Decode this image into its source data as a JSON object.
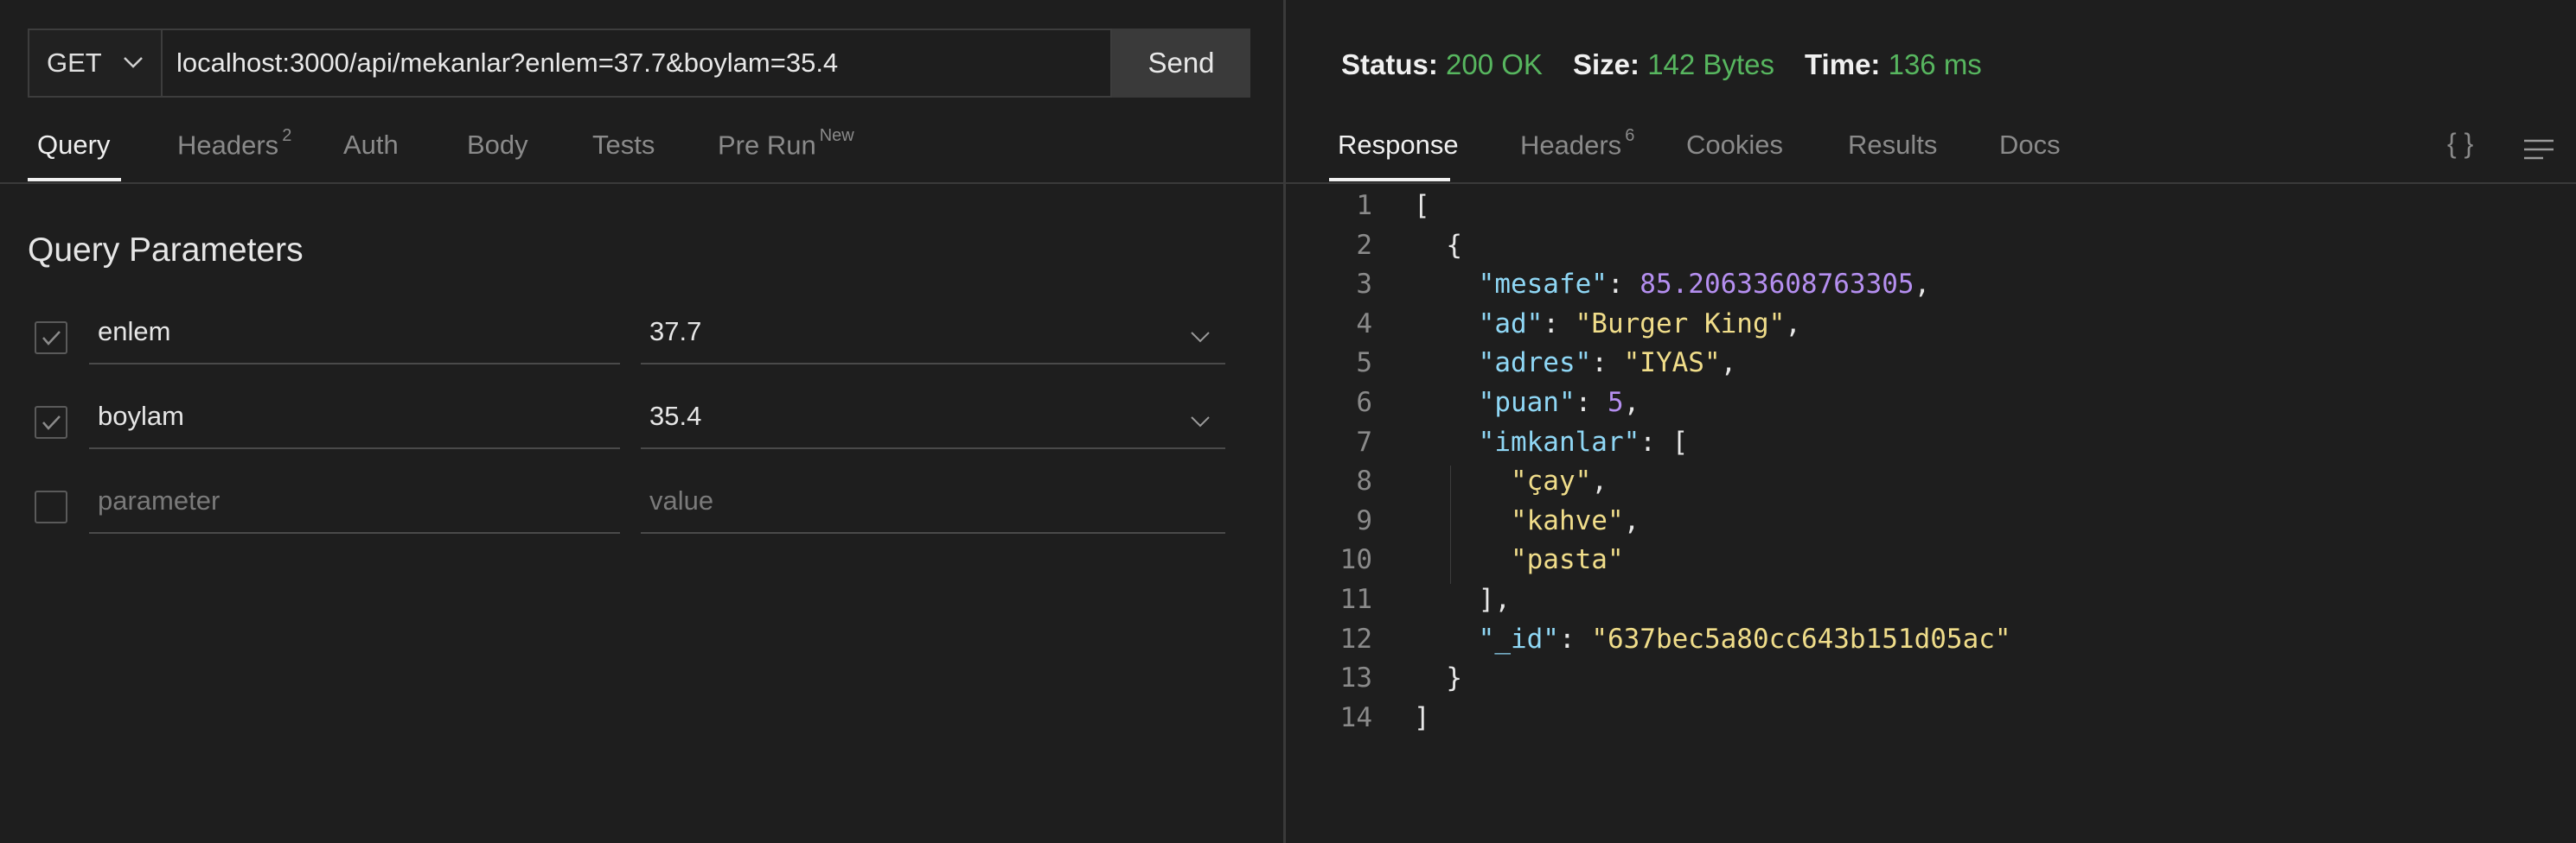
{
  "request": {
    "method": "GET",
    "url": "localhost:3000/api/mekanlar?enlem=37.7&boylam=35.4",
    "send_label": "Send"
  },
  "request_tabs": [
    {
      "label": "Query",
      "badge": ""
    },
    {
      "label": "Headers",
      "badge": "2"
    },
    {
      "label": "Auth",
      "badge": ""
    },
    {
      "label": "Body",
      "badge": ""
    },
    {
      "label": "Tests",
      "badge": ""
    },
    {
      "label": "Pre Run",
      "badge": "New"
    }
  ],
  "query": {
    "title": "Query Parameters",
    "params": [
      {
        "name": "enlem",
        "value": "37.7",
        "checked": true
      },
      {
        "name": "boylam",
        "value": "35.4",
        "checked": true
      }
    ],
    "new_row": {
      "name_placeholder": "parameter",
      "value_placeholder": "value"
    }
  },
  "response": {
    "status_label": "Status:",
    "status_value": "200 OK",
    "size_label": "Size:",
    "size_value": "142 Bytes",
    "time_label": "Time:",
    "time_value": "136 ms",
    "tabs": [
      {
        "label": "Response",
        "badge": ""
      },
      {
        "label": "Headers",
        "badge": "6"
      },
      {
        "label": "Cookies",
        "badge": ""
      },
      {
        "label": "Results",
        "badge": ""
      },
      {
        "label": "Docs",
        "badge": ""
      }
    ],
    "braces_icon_text": "{ }",
    "body_lines": [
      {
        "num": "1",
        "text": "["
      },
      {
        "num": "2",
        "text": "  {"
      },
      {
        "num": "3",
        "key": "\"mesafe\"",
        "sep": ": ",
        "num_val": "85.20633608763305",
        "tail": ","
      },
      {
        "num": "4",
        "key": "\"ad\"",
        "sep": ": ",
        "str_val": "\"Burger King\"",
        "tail": ","
      },
      {
        "num": "5",
        "key": "\"adres\"",
        "sep": ": ",
        "str_val": "\"IYAS\"",
        "tail": ","
      },
      {
        "num": "6",
        "key": "\"puan\"",
        "sep": ": ",
        "num_val": "5",
        "tail": ","
      },
      {
        "num": "7",
        "key": "\"imkanlar\"",
        "sep": ": ",
        "tail": "["
      },
      {
        "num": "8",
        "str_val": "\"çay\"",
        "tail": ","
      },
      {
        "num": "9",
        "str_val": "\"kahve\"",
        "tail": ","
      },
      {
        "num": "10",
        "str_val": "\"pasta\"",
        "tail": ""
      },
      {
        "num": "11",
        "text": "    ],"
      },
      {
        "num": "12",
        "key": "\"_id\"",
        "sep": ": ",
        "str_val": "\"637bec5a80cc643b151d05ac\"",
        "tail": ""
      },
      {
        "num": "13",
        "text": "  }"
      },
      {
        "num": "14",
        "text": "]"
      }
    ]
  }
}
